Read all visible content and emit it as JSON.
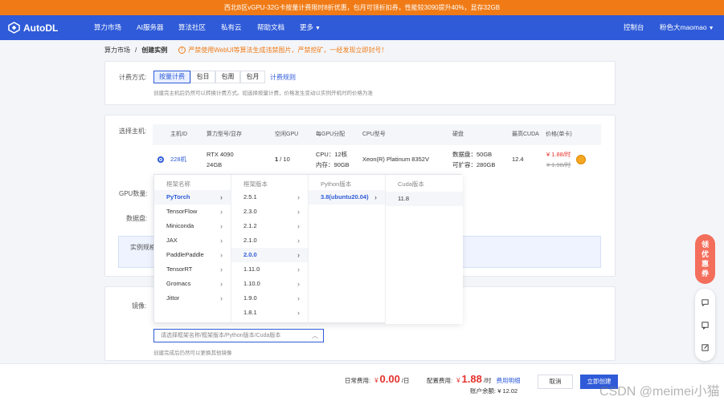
{
  "promo": {
    "text": "西北B区vGPU-32G卡按量计费限时8折优惠，包月可领折扣券，性能较3090提升40%，显存32GB"
  },
  "nav": {
    "logo": "AutoDL",
    "items": [
      "算力市场",
      "AI服务器",
      "算法社区",
      "私有云",
      "帮助文档",
      "更多"
    ],
    "console": "控制台",
    "user": "粉色大maomao"
  },
  "breadcrumb": {
    "parent": "算力市场",
    "sep": "/",
    "current": "创建实例",
    "warning": "严禁使用WebUI等算法生成违禁图片，严禁挖矿，一经发现立即封号！"
  },
  "billing": {
    "label": "计费方式:",
    "options": [
      "按量计费",
      "包日",
      "包周",
      "包月"
    ],
    "rules_link": "计费规则",
    "hint": "创建完主机后仍然可以转换计费方式。如选择按量计费，价格发生变动以实例开机时的价格为准"
  },
  "host": {
    "label": "选择主机:",
    "columns": [
      "主机ID",
      "算力型号/显存",
      "空闲GPU",
      "每GPU分配",
      "CPU型号",
      "硬盘",
      "最高CUDA",
      "价格(单卡)"
    ],
    "row": {
      "id": "228机",
      "gpu_model": "RTX 4090",
      "gpu_mem": "24GB",
      "free_gpu": "1",
      "total_gpu": "/ 10",
      "cpu": "CPU：12核",
      "mem": "内存：90GB",
      "cpu_model": "Xeon(R) Platinum 8352V",
      "disk_data": "数据盘：50GB",
      "disk_expand": "可扩容：280GB",
      "cuda": "12.4",
      "price": "¥ 1.88/时",
      "price_old": "¥ 1.98/时"
    }
  },
  "labels": {
    "gpu_count": "GPU数量:",
    "data_disk": "数据盘:",
    "instance_spec": "实例规格",
    "image": "镜像:"
  },
  "cascade": {
    "framework_header": "框架名称",
    "frameworks": [
      "PyTorch",
      "TensorFlow",
      "Miniconda",
      "JAX",
      "PaddlePaddle",
      "TensorRT",
      "Gromacs",
      "Jittor"
    ],
    "version_header": "框架版本",
    "versions": [
      "2.5.1",
      "2.3.0",
      "2.1.2",
      "2.1.0",
      "2.0.0",
      "1.11.0",
      "1.10.0",
      "1.9.0",
      "1.8.1"
    ],
    "python_header": "Python版本",
    "pythons": [
      "3.8(ubuntu20.04)"
    ],
    "cuda_header": "Cuda版本",
    "cudas": [
      "11.8"
    ]
  },
  "image_select": {
    "placeholder": "请选择框架名称/框架版本/Python版本/Cuda版本",
    "hint": "创建完成后仍然可以更换其他镜像"
  },
  "footer": {
    "daily_label": "日常费用:",
    "daily_currency": "¥",
    "daily_value": "0.00",
    "daily_unit": "/日",
    "config_label": "配置费用:",
    "config_currency": "¥",
    "config_value": "1.88",
    "config_unit": "/时",
    "detail_link": "费用明细",
    "balance_label": "账户余额:",
    "balance_value": "¥ 12.02",
    "cancel": "取消",
    "create": "立即创建"
  },
  "float": {
    "promo": "领优惠券"
  },
  "watermark": "CSDN @meimei小猫",
  "colors": {
    "brand": "#2f5bd8",
    "promo_bar": "#f07b16",
    "price": "#e5322d",
    "float_red": "#f46e5c"
  },
  "icons": [
    "autodl-logo-icon",
    "warning-icon",
    "chevron-right-icon",
    "chevron-down-icon",
    "radio-icon",
    "coupon-icon",
    "chat-icon",
    "feedback-icon",
    "edit-icon"
  ]
}
